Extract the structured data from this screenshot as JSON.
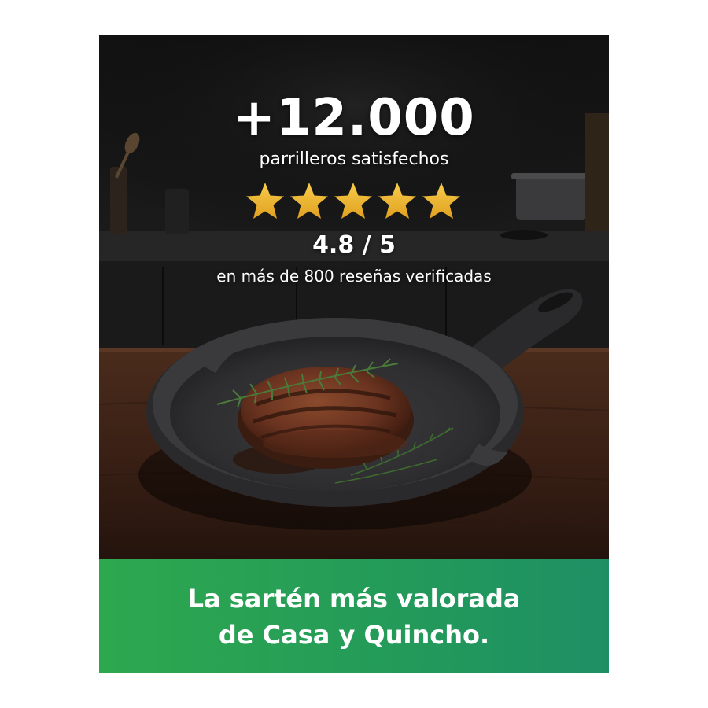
{
  "headline": "+12.000",
  "subheadline": "parrilleros satisfechos",
  "stars": {
    "count": 5,
    "color": "#f2b632",
    "icon": "star-icon"
  },
  "rating": "4.8 / 5",
  "reviews": "en más de 800 reseñas verificadas",
  "banner": {
    "text": "La sartén más valorada\nde Casa y Quincho.",
    "colors": [
      "#2ea84e",
      "#1e8f64"
    ]
  },
  "photo": {
    "subject": "cast-iron-skillet-with-steak",
    "icon": "skillet-photo"
  }
}
